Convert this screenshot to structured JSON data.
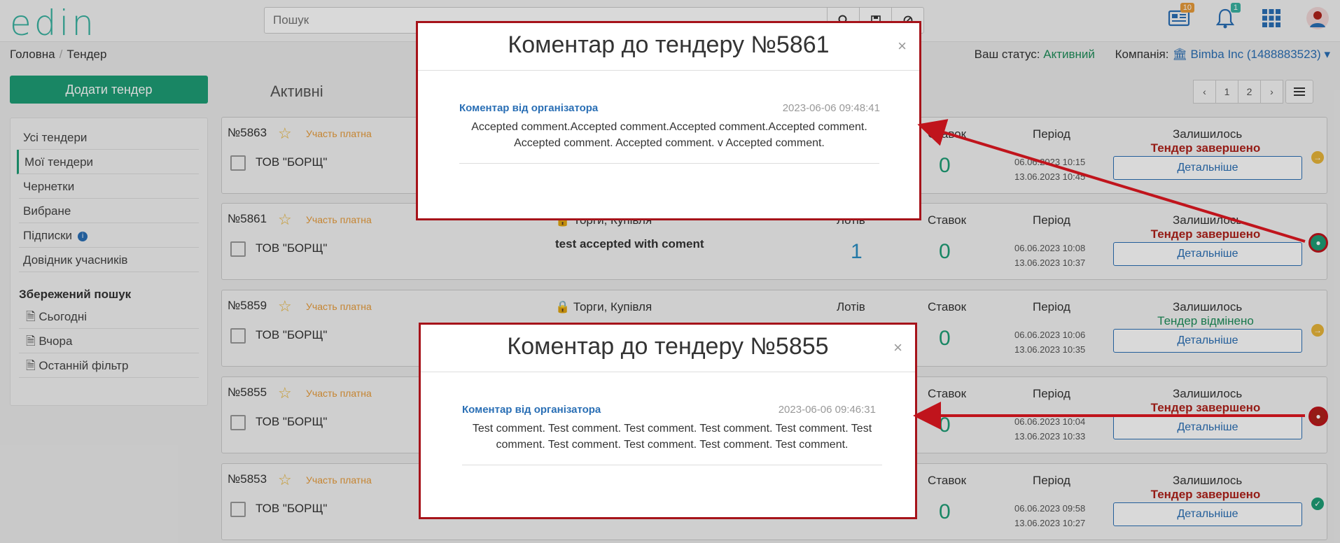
{
  "header": {
    "logo": "edin",
    "search_placeholder": "Пошук",
    "notif_news": "10",
    "notif_bell": "1"
  },
  "breadcrumb": {
    "home": "Головна",
    "current": "Тендер"
  },
  "status": {
    "label": "Ваш статус:",
    "value": "Активний",
    "company_label": "Компанія:",
    "company": "Bimba Inc (1488883523)"
  },
  "sidebar": {
    "add_button": "Додати тендер",
    "items": [
      "Усі тендери",
      "Мої тендери",
      "Чернетки",
      "Вибране",
      "Підписки",
      "Довідник учасників"
    ],
    "saved_title": "Збережений пошук",
    "saved": [
      "Сьогодні",
      "Вчора",
      "Останній фільтр"
    ]
  },
  "main": {
    "tab": "Активні",
    "pages": [
      "‹",
      "1",
      "2",
      "›"
    ]
  },
  "labels": {
    "lots": "Лотів",
    "bids": "Ставок",
    "period": "Період",
    "remaining": "Залишилось",
    "details": "Детальніше",
    "fee": "Участь платна"
  },
  "cards": [
    {
      "num": "№5863",
      "org": "ТОВ \"БОРЩ\"",
      "type": "",
      "name": "",
      "lots": "",
      "bids": "0",
      "p1": "06.06.2023 10:15",
      "p2": "13.06.2023 10:45",
      "status": "Тендер завершено"
    },
    {
      "num": "№5861",
      "org": "ТОВ \"БОРЩ\"",
      "type": "Торги, Купівля",
      "name": "test accepted with coment",
      "lots": "1",
      "bids": "0",
      "p1": "06.06.2023 10:08",
      "p2": "13.06.2023 10:37",
      "status": "Тендер завершено"
    },
    {
      "num": "№5859",
      "org": "ТОВ \"БОРЩ\"",
      "type": "Торги, Купівля",
      "name": "",
      "lots": "",
      "bids": "0",
      "p1": "06.06.2023 10:06",
      "p2": "13.06.2023 10:35",
      "status": "Тендер відмінено"
    },
    {
      "num": "№5855",
      "org": "ТОВ \"БОРЩ\"",
      "type": "",
      "name": "",
      "lots": "",
      "bids": "0",
      "p1": "06.06.2023 10:04",
      "p2": "13.06.2023 10:33",
      "status": "Тендер завершено"
    },
    {
      "num": "№5853",
      "org": "ТОВ \"БОРЩ\"",
      "type": "",
      "name": "",
      "lots": "",
      "bids": "0",
      "p1": "06.06.2023 09:58",
      "p2": "13.06.2023 10:27",
      "status": "Тендер завершено"
    }
  ],
  "modals": [
    {
      "title": "Коментар до тендеру №5861",
      "from": "Коментар від організатора",
      "date": "2023-06-06 09:48:41",
      "text": "Accepted comment.Accepted comment.Accepted comment.Accepted comment. Accepted comment. Accepted comment. v Accepted comment."
    },
    {
      "title": "Коментар до тендеру №5855",
      "from": "Коментар від організатора",
      "date": "2023-06-06 09:46:31",
      "text": "Test comment. Test comment. Test comment. Test comment. Test comment. Test comment. Test comment. Test comment. Test comment. Test comment."
    }
  ],
  "colors": {
    "accent": "#1e9e76",
    "danger": "#b0211b",
    "link": "#2a6fb5",
    "highlight": "#a6131a"
  }
}
